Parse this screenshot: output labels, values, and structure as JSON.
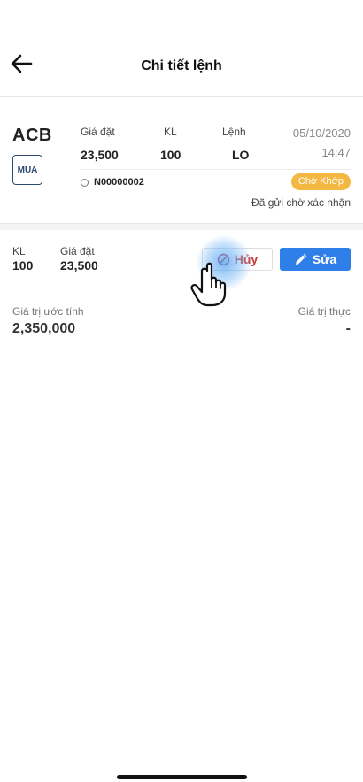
{
  "header": {
    "title": "Chi tiết lệnh",
    "back_icon": "arrow-left-icon"
  },
  "order": {
    "symbol": "ACB",
    "side": "MUA",
    "columns": [
      {
        "label": "Giá đặt",
        "value": "23,500"
      },
      {
        "label": "KL",
        "value": "100"
      },
      {
        "label": "Lệnh",
        "value": "LO"
      }
    ],
    "date": "05/10/2020",
    "time": "14:47",
    "order_id": "N00000002",
    "status": "Chờ Khớp",
    "status_color": "#f4b842",
    "status_note": "Đã gửi chờ xác nhận"
  },
  "actions": {
    "kl_label": "KL",
    "kl_value": "100",
    "price_label": "Giá đặt",
    "price_value": "23,500",
    "cancel_label": "Hủy",
    "cancel_icon": "ban-icon",
    "edit_label": "Sửa",
    "edit_icon": "pencil-icon",
    "cancel_color": "#c83a3a",
    "edit_color": "#2f7fe8"
  },
  "values": {
    "estimated_label": "Giá trị ước tính",
    "estimated_value": "2,350,000",
    "actual_label": "Giá trị thực",
    "actual_value": "-"
  }
}
